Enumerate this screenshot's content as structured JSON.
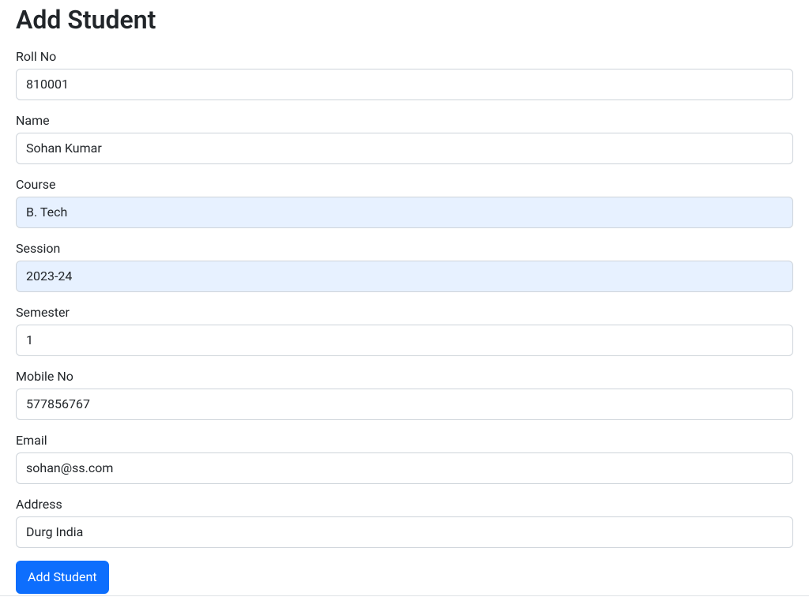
{
  "page": {
    "title": "Add Student"
  },
  "form": {
    "roll_no": {
      "label": "Roll No",
      "value": "810001"
    },
    "name": {
      "label": "Name",
      "value": "Sohan Kumar"
    },
    "course": {
      "label": "Course",
      "value": "B. Tech"
    },
    "session": {
      "label": "Session",
      "value": "2023-24"
    },
    "semester": {
      "label": "Semester",
      "value": "1"
    },
    "mobile_no": {
      "label": "Mobile No",
      "value": "577856767"
    },
    "email": {
      "label": "Email",
      "value": "sohan@ss.com"
    },
    "address": {
      "label": "Address",
      "value": "Durg India"
    },
    "submit_label": "Add Student"
  }
}
